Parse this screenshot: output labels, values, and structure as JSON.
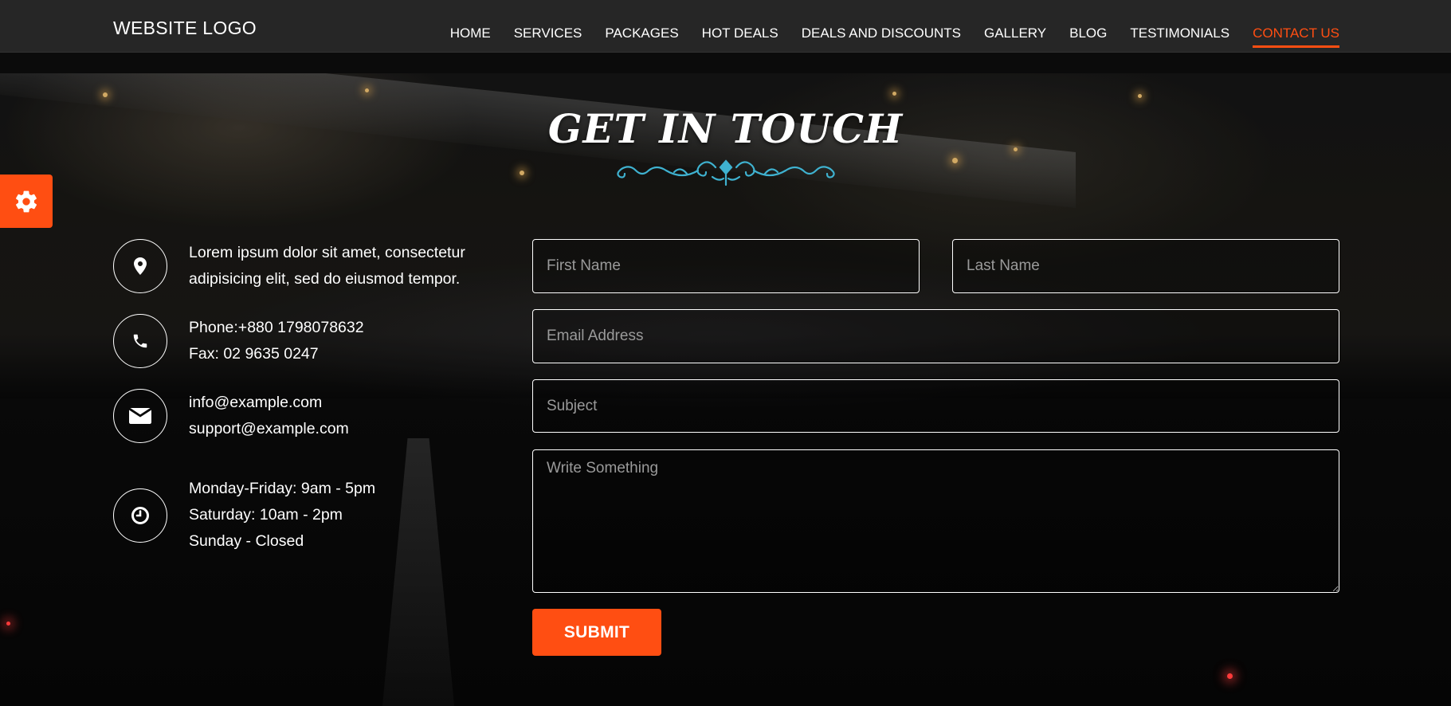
{
  "header": {
    "logo": "WEBSITE LOGO",
    "nav": [
      {
        "label": "HOME",
        "active": false
      },
      {
        "label": "SERVICES",
        "active": false
      },
      {
        "label": "PACKAGES",
        "active": false
      },
      {
        "label": "HOT DEALS",
        "active": false
      },
      {
        "label": "DEALS AND DISCOUNTS",
        "active": false
      },
      {
        "label": "GALLERY",
        "active": false
      },
      {
        "label": "BLOG",
        "active": false
      },
      {
        "label": "TESTIMONIALS",
        "active": false
      },
      {
        "label": "CONTACT US",
        "active": true
      }
    ]
  },
  "settings": {
    "icon": "gear-icon"
  },
  "section": {
    "title": "GET IN TOUCH"
  },
  "contact": {
    "address": {
      "icon": "map-pin-icon",
      "lines": [
        "Lorem ipsum dolor sit amet, consectetur",
        "adipisicing elit, sed do eiusmod tempor."
      ]
    },
    "phone": {
      "icon": "phone-icon",
      "lines": [
        "Phone:+880 1798078632",
        "Fax: 02 9635 0247"
      ]
    },
    "email": {
      "icon": "envelope-icon",
      "lines": [
        "info@example.com",
        "support@example.com"
      ]
    },
    "hours": {
      "icon": "clock-icon",
      "lines": [
        "Monday-Friday: 9am - 5pm",
        "Saturday: 10am - 2pm",
        "Sunday - Closed"
      ]
    }
  },
  "form": {
    "first_name": {
      "placeholder": "First Name",
      "value": ""
    },
    "last_name": {
      "placeholder": "Last Name",
      "value": ""
    },
    "email": {
      "placeholder": "Email Address",
      "value": ""
    },
    "subject": {
      "placeholder": "Subject",
      "value": ""
    },
    "message": {
      "placeholder": "Write Something",
      "value": ""
    },
    "submit_label": "SUBMIT"
  },
  "colors": {
    "accent": "#ff4e12",
    "ornament": "#3fb2d0",
    "header_bg": "#262626"
  }
}
